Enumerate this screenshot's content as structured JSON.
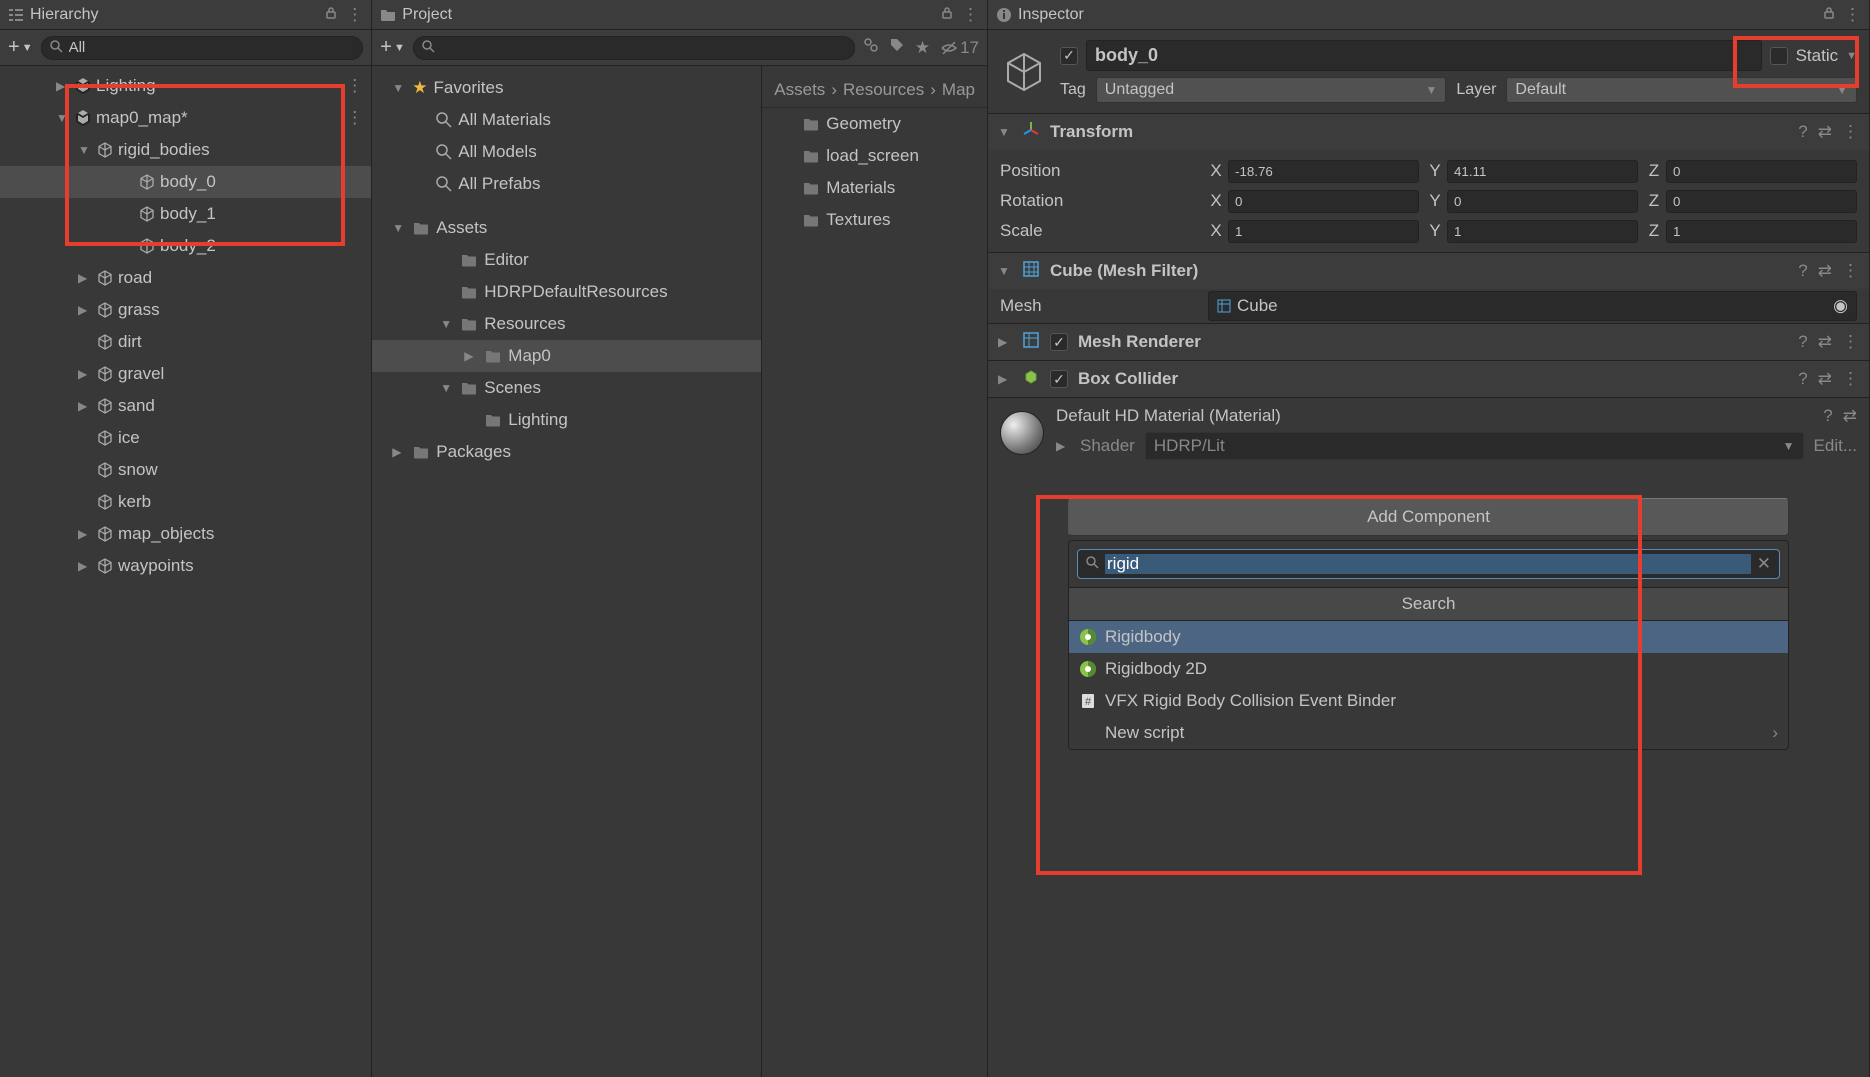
{
  "hierarchy": {
    "title": "Hierarchy",
    "search_value": "All",
    "items": [
      {
        "label": "Lighting",
        "icon": "unity",
        "indent": 1,
        "has_arrow": true,
        "arrow": "▶",
        "has_menu": true
      },
      {
        "label": "map0_map*",
        "icon": "unity",
        "indent": 1,
        "has_arrow": true,
        "arrow": "▼",
        "has_menu": true
      },
      {
        "label": "rigid_bodies",
        "icon": "cube",
        "indent": 2,
        "has_arrow": true,
        "arrow": "▼"
      },
      {
        "label": "body_0",
        "icon": "cube",
        "indent": 3,
        "selected": true
      },
      {
        "label": "body_1",
        "icon": "cube",
        "indent": 3
      },
      {
        "label": "body_2",
        "icon": "cube",
        "indent": 3
      },
      {
        "label": "road",
        "icon": "cube",
        "indent": 2,
        "has_arrow": true,
        "arrow": "▶"
      },
      {
        "label": "grass",
        "icon": "cube",
        "indent": 2,
        "has_arrow": true,
        "arrow": "▶"
      },
      {
        "label": "dirt",
        "icon": "cube",
        "indent": 2
      },
      {
        "label": "gravel",
        "icon": "cube",
        "indent": 2,
        "has_arrow": true,
        "arrow": "▶"
      },
      {
        "label": "sand",
        "icon": "cube",
        "indent": 2,
        "has_arrow": true,
        "arrow": "▶"
      },
      {
        "label": "ice",
        "icon": "cube",
        "indent": 2
      },
      {
        "label": "snow",
        "icon": "cube",
        "indent": 2
      },
      {
        "label": "kerb",
        "icon": "cube",
        "indent": 2
      },
      {
        "label": "map_objects",
        "icon": "cube",
        "indent": 2,
        "has_arrow": true,
        "arrow": "▶"
      },
      {
        "label": "waypoints",
        "icon": "cube",
        "indent": 2,
        "has_arrow": true,
        "arrow": "▶"
      }
    ]
  },
  "project": {
    "title": "Project",
    "hidden_count": "17",
    "left_tree": {
      "favorites": {
        "title": "Favorites",
        "items": [
          "All Materials",
          "All Models",
          "All Prefabs"
        ]
      },
      "assets": {
        "title": "Assets",
        "items": [
          {
            "label": "Editor",
            "indent": 3
          },
          {
            "label": "HDRPDefaultResources",
            "indent": 3
          },
          {
            "label": "Resources",
            "indent": 3,
            "arrow": "▼"
          },
          {
            "label": "Map0",
            "indent": 4,
            "arrow": "▶",
            "selected": true
          },
          {
            "label": "Scenes",
            "indent": 3,
            "arrow": "▼"
          },
          {
            "label": "Lighting",
            "indent": 4
          }
        ]
      },
      "packages": "Packages"
    },
    "breadcrumb": [
      "Assets",
      "Resources",
      "Map"
    ],
    "right_items": [
      "Geometry",
      "load_screen",
      "Materials",
      "Textures"
    ]
  },
  "inspector": {
    "title": "Inspector",
    "object_name": "body_0",
    "enabled": true,
    "static_label": "Static",
    "tag_label": "Tag",
    "tag_value": "Untagged",
    "layer_label": "Layer",
    "layer_value": "Default",
    "transform": {
      "title": "Transform",
      "position": {
        "label": "Position",
        "x": "-18.76",
        "y": "41.11",
        "z": "0"
      },
      "rotation": {
        "label": "Rotation",
        "x": "0",
        "y": "0",
        "z": "0"
      },
      "scale": {
        "label": "Scale",
        "x": "1",
        "y": "1",
        "z": "1"
      }
    },
    "mesh_filter": {
      "title": "Cube (Mesh Filter)",
      "mesh_label": "Mesh",
      "mesh_value": "Cube"
    },
    "mesh_renderer": {
      "title": "Mesh Renderer"
    },
    "box_collider": {
      "title": "Box Collider"
    },
    "material": {
      "title": "Default HD Material (Material)",
      "shader_label": "Shader",
      "shader_value": "HDRP/Lit",
      "edit_label": "Edit..."
    },
    "add_component": {
      "button": "Add Component",
      "search_value": "rigid",
      "header": "Search",
      "results": [
        {
          "label": "Rigidbody",
          "icon": "physics",
          "highlighted": true
        },
        {
          "label": "Rigidbody 2D",
          "icon": "physics"
        },
        {
          "label": "VFX Rigid Body Collision Event Binder",
          "icon": "script"
        },
        {
          "label": "New script",
          "icon": "",
          "arrow": true
        }
      ]
    }
  }
}
